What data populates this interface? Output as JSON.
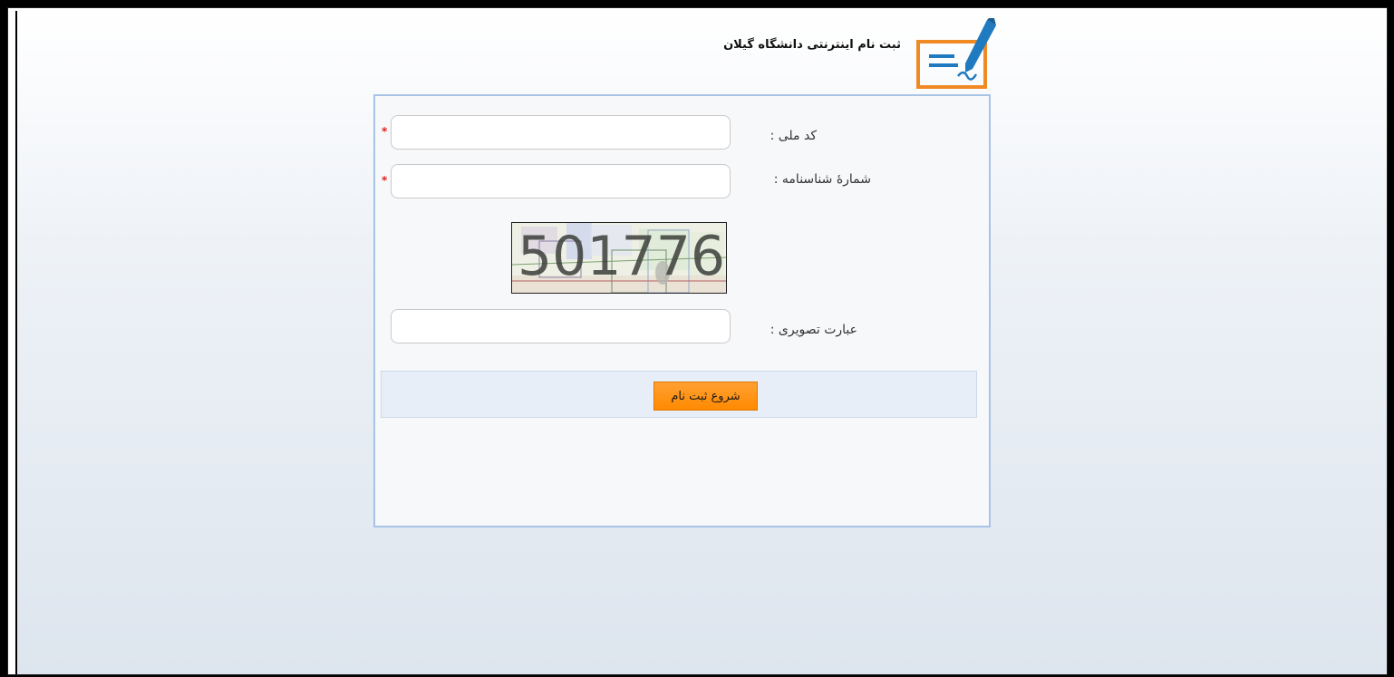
{
  "header": {
    "title": "ثبت نام اینترنتی دانشگاه گیلان",
    "logo_icon": "signature-pen-icon"
  },
  "form": {
    "national_code": {
      "label": "کد ملی :",
      "value": "",
      "required_mark": "*"
    },
    "id_number": {
      "label": "شمارهٔ شناسنامه :",
      "value": "",
      "required_mark": "*"
    },
    "captcha": {
      "text": "501776"
    },
    "captcha_answer": {
      "label": "عبارت تصویری :",
      "value": ""
    },
    "submit_label": "شروع ثبت نام"
  },
  "colors": {
    "accent_orange": "#ff8a00",
    "panel_border": "#a9c3e6",
    "required_red": "#e21b1b"
  }
}
